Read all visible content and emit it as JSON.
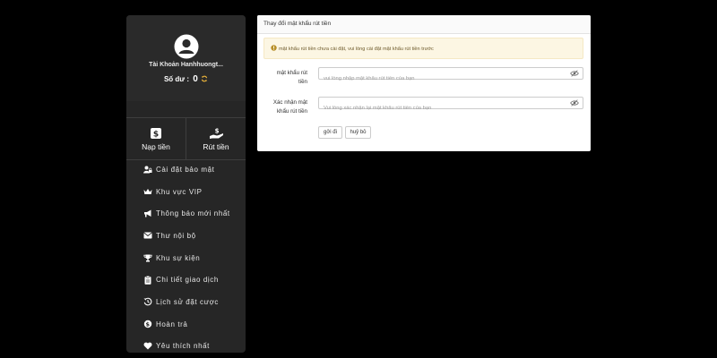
{
  "sidebar": {
    "username": "Tài Khoản Hanhhuongt...",
    "balance_label": "Số dư :",
    "balance_value": "0",
    "actions": [
      {
        "label": "Nạp tiền",
        "icon": "deposit-icon"
      },
      {
        "label": "Rút tiền",
        "icon": "withdraw-icon"
      }
    ],
    "menu": [
      {
        "label": "Cài đặt bảo mật",
        "icon": "user-lock-icon"
      },
      {
        "label": "Khu vực VIP",
        "icon": "crown-icon"
      },
      {
        "label": "Thông báo mới nhất",
        "icon": "megaphone-icon"
      },
      {
        "label": "Thư nội bộ",
        "icon": "envelope-icon"
      },
      {
        "label": "Khu sự kiện",
        "icon": "trophy-icon"
      },
      {
        "label": "Chi tiết giao dịch",
        "icon": "clipboard-icon"
      },
      {
        "label": "Lịch sử đặt cược",
        "icon": "history-icon"
      },
      {
        "label": "Hoàn trả",
        "icon": "coin-icon"
      },
      {
        "label": "Yêu thích nhất",
        "icon": "heart-icon"
      }
    ]
  },
  "panel": {
    "title": "Thay đổi mật khẩu rút tiền",
    "alert": "mật khẩu rút tiền chưa cài đặt, vui lòng cài đặt mật khẩu rút tiền trước",
    "fields": [
      {
        "label_line1": "mật khẩu rút",
        "label_line2": "tiền",
        "placeholder": "vui lòng nhập mật khẩu rút tiền của bạn",
        "value": ""
      },
      {
        "label_line1": "Xác nhận mật",
        "label_line2": "khẩu rút tiền",
        "placeholder": "Vui lòng xác nhận lại mật khẩu rút tiền của bạn",
        "value": ""
      }
    ],
    "submit_label": "gởi đi",
    "cancel_label": "huỷ bỏ"
  },
  "colors": {
    "page_bg": "#000000",
    "sidebar_bg": "#262626",
    "alert_bg": "#fcf6e3",
    "refresh_icon": "#e8b23a"
  }
}
